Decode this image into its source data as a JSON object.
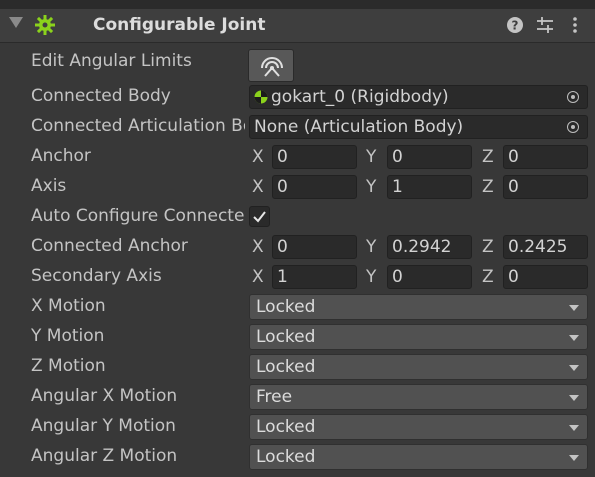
{
  "header": {
    "title": "Configurable Joint",
    "icons": [
      "foldout-arrow",
      "joint-gear-icon",
      "help-icon",
      "presets-icon",
      "more-icon"
    ]
  },
  "rows": {
    "edit_angular_limits": "Edit Angular Limits",
    "connected_body": {
      "label": "Connected Body",
      "value": "gokart_0 (Rigidbody)"
    },
    "connected_articulation": {
      "label": "Connected Articulation Body",
      "value": "None (Articulation Body)"
    },
    "anchor": {
      "label": "Anchor",
      "x": "0",
      "y": "0",
      "z": "0"
    },
    "axis": {
      "label": "Axis",
      "x": "0",
      "y": "1",
      "z": "0"
    },
    "auto_configure": {
      "label": "Auto Configure Connected Anchor",
      "checked": true
    },
    "connected_anchor": {
      "label": "Connected Anchor",
      "x": "0",
      "y": "0.2942",
      "z": "0.2425"
    },
    "secondary_axis": {
      "label": "Secondary Axis",
      "x": "1",
      "y": "0",
      "z": "0"
    },
    "x_motion": {
      "label": "X Motion",
      "value": "Locked"
    },
    "y_motion": {
      "label": "Y Motion",
      "value": "Locked"
    },
    "z_motion": {
      "label": "Z Motion",
      "value": "Locked"
    },
    "ang_x_motion": {
      "label": "Angular X Motion",
      "value": "Free"
    },
    "ang_y_motion": {
      "label": "Angular Y Motion",
      "value": "Locked"
    },
    "ang_z_motion": {
      "label": "Angular Z Motion",
      "value": "Locked"
    }
  },
  "axis_letters": {
    "x": "X",
    "y": "Y",
    "z": "Z"
  },
  "colors": {
    "background": "#383838",
    "field": "#2a2a2a",
    "dropdown": "#515151",
    "accent_green": "#8bd21c"
  }
}
